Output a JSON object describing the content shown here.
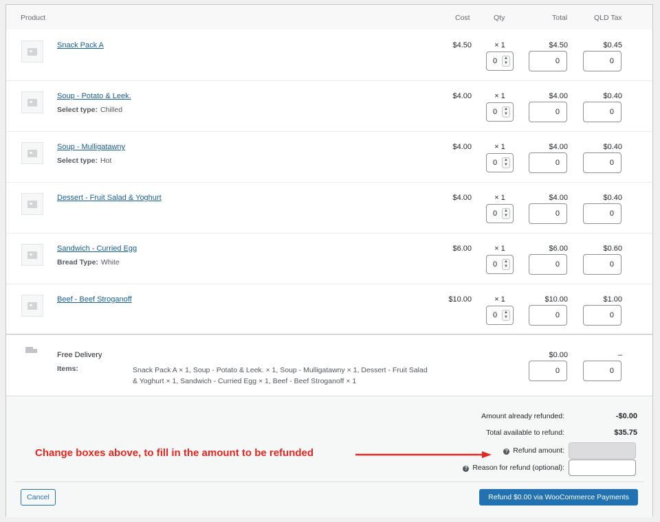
{
  "headers": {
    "product": "Product",
    "cost": "Cost",
    "qty": "Qty",
    "total": "Total",
    "tax": "QLD Tax"
  },
  "items": [
    {
      "name": "Snack Pack A",
      "meta_key": "",
      "meta_val": "",
      "cost": "$4.50",
      "qty": "× 1",
      "total": "$4.50",
      "tax": "$0.45",
      "refund_qty": "0",
      "refund_total": "0",
      "refund_tax": "0"
    },
    {
      "name": "Soup - Potato & Leek.",
      "meta_key": "Select type:",
      "meta_val": "Chilled",
      "cost": "$4.00",
      "qty": "× 1",
      "total": "$4.00",
      "tax": "$0.40",
      "refund_qty": "0",
      "refund_total": "0",
      "refund_tax": "0"
    },
    {
      "name": "Soup - Mulligatawny",
      "meta_key": "Select type:",
      "meta_val": "Hot",
      "cost": "$4.00",
      "qty": "× 1",
      "total": "$4.00",
      "tax": "$0.40",
      "refund_qty": "0",
      "refund_total": "0",
      "refund_tax": "0"
    },
    {
      "name": "Dessert - Fruit Salad & Yoghurt",
      "meta_key": "",
      "meta_val": "",
      "cost": "$4.00",
      "qty": "× 1",
      "total": "$4.00",
      "tax": "$0.40",
      "refund_qty": "0",
      "refund_total": "0",
      "refund_tax": "0"
    },
    {
      "name": "Sandwich - Curried Egg",
      "meta_key": "Bread Type:",
      "meta_val": "White",
      "cost": "$6.00",
      "qty": "× 1",
      "total": "$6.00",
      "tax": "$0.60",
      "refund_qty": "0",
      "refund_total": "0",
      "refund_tax": "0"
    },
    {
      "name": "Beef - Beef Stroganoff",
      "meta_key": "",
      "meta_val": "",
      "cost": "$10.00",
      "qty": "× 1",
      "total": "$10.00",
      "tax": "$1.00",
      "refund_qty": "0",
      "refund_total": "0",
      "refund_tax": "0"
    }
  ],
  "shipping": {
    "name": "Free Delivery",
    "items_label": "Items:",
    "items_text": "Snack Pack A × 1, Soup - Potato & Leek. × 1, Soup - Mulligatawny × 1, Dessert - Fruit Salad & Yoghurt × 1, Sandwich - Curried Egg × 1, Beef - Beef Stroganoff × 1",
    "total": "$0.00",
    "tax": "–",
    "refund_total": "0",
    "refund_tax": "0"
  },
  "summary": {
    "already_label": "Amount already refunded:",
    "already_value": "-$0.00",
    "available_label": "Total available to refund:",
    "available_value": "$35.75",
    "refund_amount_label": "Refund amount:",
    "reason_label": "Reason for refund (optional):",
    "annotation": "Change boxes above, to fill in the amount to be refunded"
  },
  "buttons": {
    "cancel": "Cancel",
    "refund": "Refund $0.00 via WooCommerce Payments"
  },
  "colors": {
    "link": "#135e96",
    "primary": "#2271b1",
    "annotation": "#e3261f"
  }
}
